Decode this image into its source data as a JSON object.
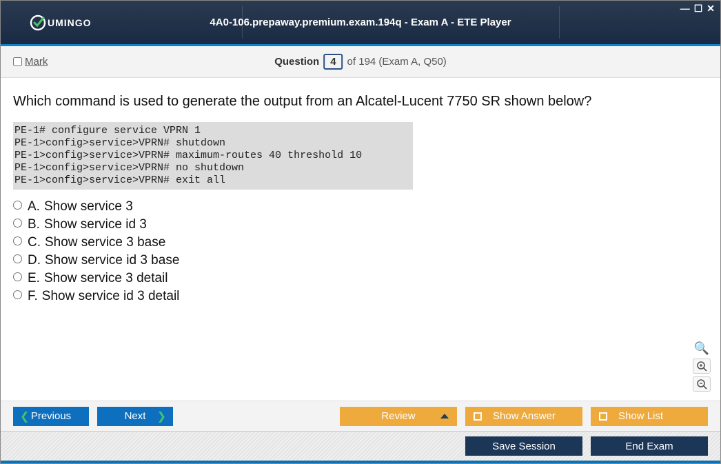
{
  "window": {
    "title": "4A0-106.prepaway.premium.exam.194q - Exam A - ETE Player",
    "brand": "UMINGO"
  },
  "infobar": {
    "mark_label": "Mark",
    "question_word": "Question",
    "current_number": "4",
    "of_text": "of 194 (Exam A, Q50)"
  },
  "question": {
    "text": "Which command is used to generate the output from an Alcatel-Lucent 7750 SR shown below?",
    "code": "PE-1# configure service VPRN 1\nPE-1>config>service>VPRN# shutdown\nPE-1>config>service>VPRN# maximum-routes 40 threshold 10\nPE-1>config>service>VPRN# no shutdown\nPE-1>config>service>VPRN# exit all",
    "options": [
      {
        "letter": "A.",
        "text": "Show service 3"
      },
      {
        "letter": "B.",
        "text": "Show service id 3"
      },
      {
        "letter": "C.",
        "text": "Show service 3 base"
      },
      {
        "letter": "D.",
        "text": "Show service id 3 base"
      },
      {
        "letter": "E.",
        "text": "Show service 3 detail"
      },
      {
        "letter": "F.",
        "text": "Show service id 3 detail"
      }
    ]
  },
  "buttons": {
    "previous": "Previous",
    "next": "Next",
    "review": "Review",
    "show_answer": "Show Answer",
    "show_list": "Show List",
    "save_session": "Save Session",
    "end_exam": "End Exam"
  }
}
